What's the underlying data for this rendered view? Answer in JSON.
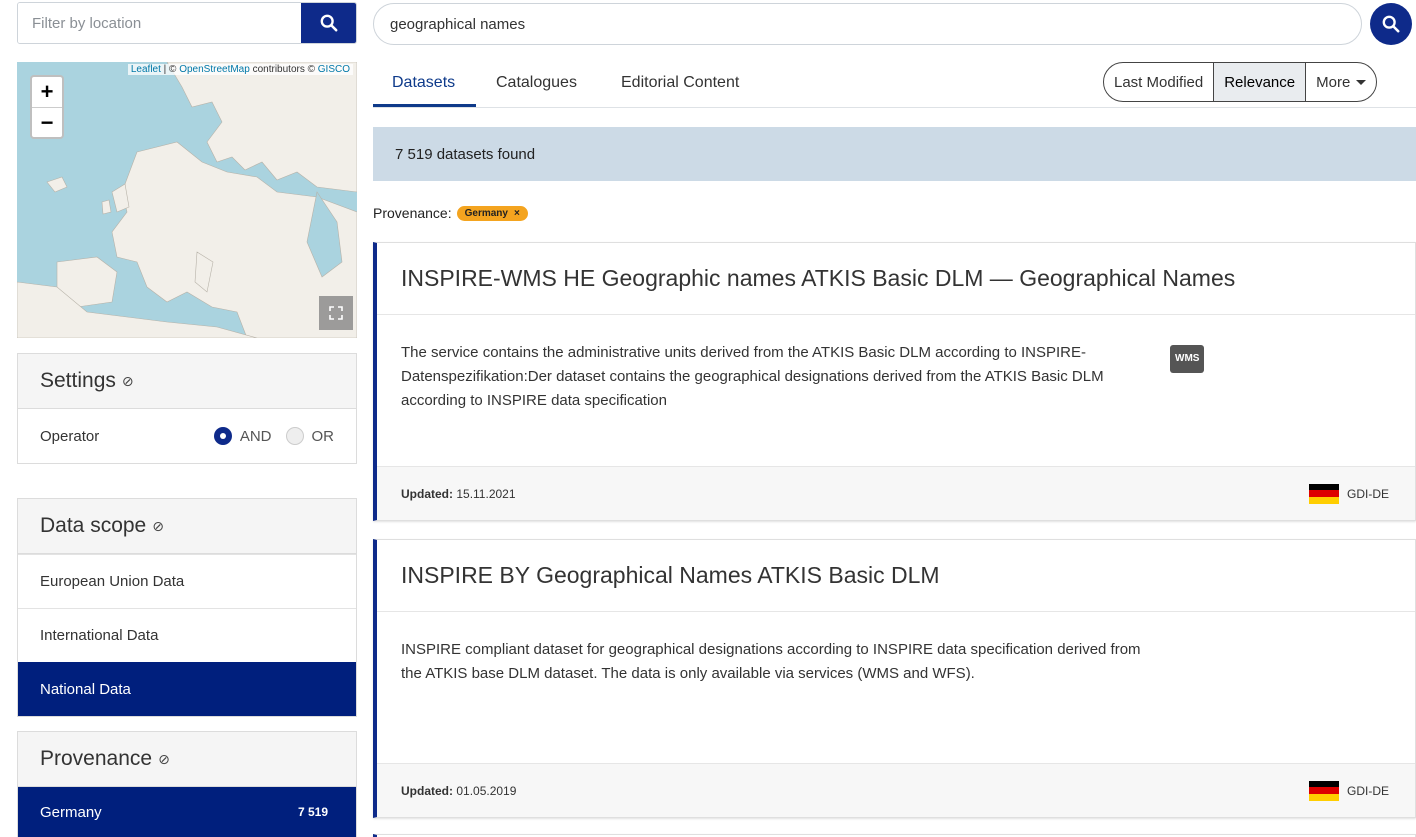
{
  "location_filter": {
    "placeholder": "Filter by location"
  },
  "map": {
    "attribution_leaflet": "Leaflet",
    "attribution_mid": " | © ",
    "attribution_osm": "OpenStreetMap",
    "attribution_contrib": " contributors © ",
    "attribution_gisco": "GISCO",
    "zoom_in": "+",
    "zoom_out": "−"
  },
  "settings": {
    "title": "Settings",
    "help": "⊘",
    "operator_label": "Operator",
    "options": [
      {
        "label": "AND",
        "selected": true
      },
      {
        "label": "OR",
        "selected": false
      }
    ]
  },
  "data_scope": {
    "title": "Data scope",
    "items": [
      {
        "label": "European Union Data",
        "active": false
      },
      {
        "label": "International Data",
        "active": false
      },
      {
        "label": "National Data",
        "active": true
      }
    ]
  },
  "provenance_facet": {
    "title": "Provenance",
    "items": [
      {
        "label": "Germany",
        "count": "7 519"
      }
    ]
  },
  "search": {
    "value": "geographical names"
  },
  "tabs": [
    {
      "label": "Datasets",
      "active": true
    },
    {
      "label": "Catalogues",
      "active": false
    },
    {
      "label": "Editorial Content",
      "active": false
    }
  ],
  "sort": {
    "options": [
      {
        "label": "Last Modified",
        "selected": false
      },
      {
        "label": "Relevance",
        "selected": true
      },
      {
        "label": "More",
        "selected": false
      }
    ]
  },
  "results": {
    "summary": "7 519 datasets found"
  },
  "active_filter": {
    "label": "Provenance:",
    "badge": "Germany",
    "remove": "×"
  },
  "datasets": [
    {
      "title": "INSPIRE-WMS HE Geographic names ATKIS Basic DLM — Geographical Names",
      "description": "The service contains the administrative units derived from the ATKIS Basic DLM according to INSPIRE-Datenspezifikation:Der dataset contains the geographical designations derived from the ATKIS Basic DLM according to INSPIRE data specification",
      "format": "WMS",
      "updated_label": "Updated:",
      "updated": "15.11.2021",
      "publisher": "GDI-DE"
    },
    {
      "title": "INSPIRE BY Geographical Names ATKIS Basic DLM",
      "description": "INSPIRE compliant dataset for geographical designations according to INSPIRE data specification derived from the ATKIS base DLM dataset. The data is only available via services (WMS and WFS).",
      "format": "",
      "updated_label": "Updated:",
      "updated": "01.05.2019",
      "publisher": "GDI-DE"
    }
  ],
  "colors": {
    "primary": "#0e2a8a",
    "active_bg": "#001f7d",
    "results_bar": "#ccdae6",
    "badge": "#f4a41f",
    "flag_black": "#000000",
    "flag_red": "#dd0000",
    "flag_gold": "#ffce00"
  }
}
